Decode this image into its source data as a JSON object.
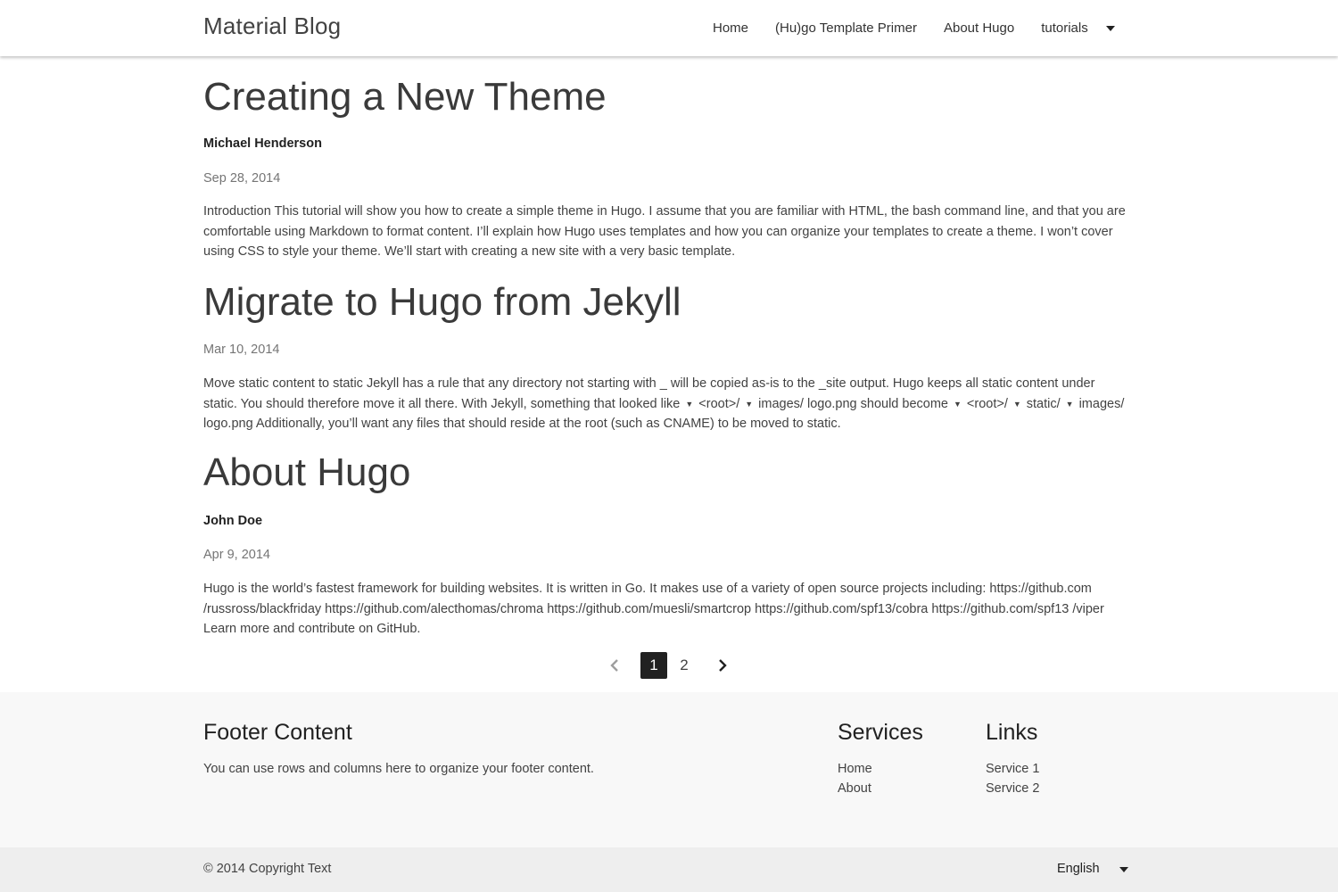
{
  "header": {
    "brand": "Material Blog",
    "nav": [
      {
        "label": "Home"
      },
      {
        "label": "(Hu)go Template Primer"
      },
      {
        "label": "About Hugo"
      },
      {
        "label": "tutorials"
      }
    ],
    "dropdown_icon": "caret-down-icon"
  },
  "posts": [
    {
      "title": "Creating a New Theme",
      "author": "Michael Henderson",
      "date": "Sep 28, 2014",
      "summary": "Introduction This tutorial will show you how to create a simple theme in Hugo. I assume that you are familiar with HTML, the bash command line, and that you are comfortable using Markdown to format content. I’ll explain how Hugo uses templates and how you can organize your templates to create a theme. I won’t cover using CSS to style your theme. We’ll start with creating a new site with a very basic template."
    },
    {
      "title": "Migrate to Hugo from Jekyll",
      "date": "Mar 10, 2014",
      "summary_parts": [
        "Move static content to static Jekyll has a rule that any directory not starting with _ will be copied as-is to the _site output. Hugo keeps all static content under static. You should therefore move it all there. With Jekyll, something that looked like",
        "<root>/",
        "images/ logo.png should become",
        "<root>/",
        "static/",
        "images/ logo.png Additionally, you’ll want any files that should reside at the root (such as CNAME) to be moved to static."
      ],
      "bullet_icon": "triangle-bullet-icon"
    },
    {
      "title": "About Hugo",
      "author": "John Doe",
      "date": "Apr 9, 2014",
      "summary": "Hugo is the world’s fastest framework for building websites. It is written in Go. It makes use of a variety of open source projects including: https://github.com /russross/blackfriday https://github.com/alecthomas/chroma https://github.com/muesli/smartcrop https://github.com/spf13/cobra https://github.com/spf13 /viper Learn more and contribute on GitHub."
    }
  ],
  "pagination": {
    "prev_icon": "chevron-left-icon",
    "pages": [
      "1",
      "2"
    ],
    "current": "1",
    "next_icon": "chevron-right-icon"
  },
  "footer": {
    "content_title": "Footer Content",
    "content_text": "You can use rows and columns here to organize your footer content.",
    "services_title": "Services",
    "services": [
      "Home",
      "About"
    ],
    "links_title": "Links",
    "links": [
      "Service 1",
      "Service 2"
    ],
    "copyright": "© 2014 Copyright Text",
    "language": "English"
  },
  "colors": {
    "page_background": "#ffffff",
    "footer_background": "#f8f8f8",
    "copyright_background": "#eeeeee",
    "active_page": "#212121"
  }
}
